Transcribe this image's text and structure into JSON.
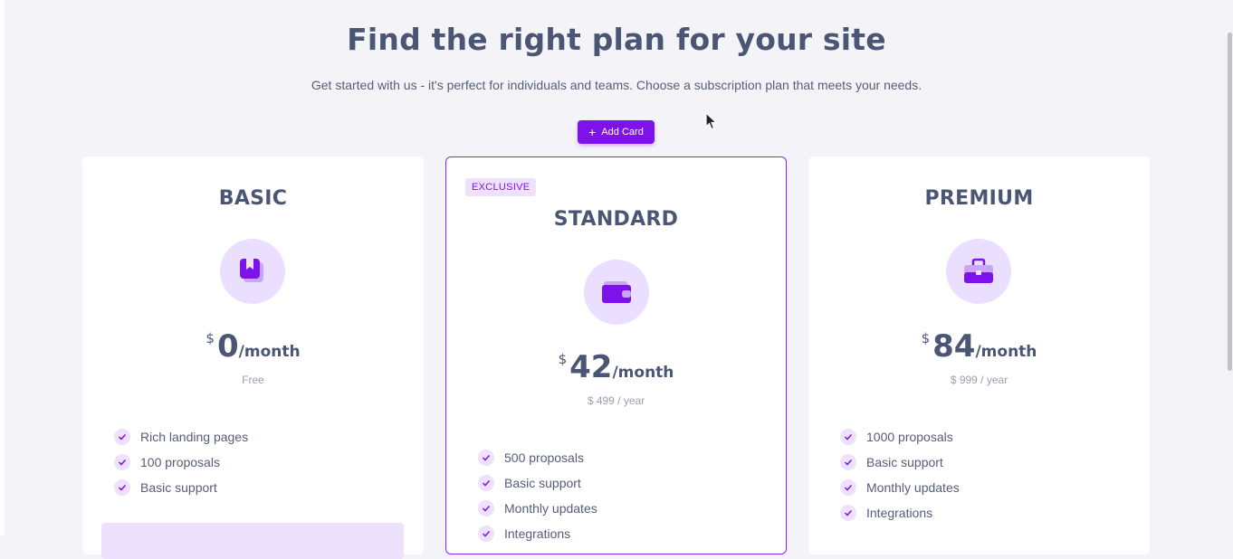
{
  "header": {
    "title": "Find the right plan for your site",
    "subtitle": "Get started with us - it's perfect for individuals and teams. Choose a subscription plan that meets your needs.",
    "add_button_label": "Add Card"
  },
  "colors": {
    "accent": "#7d12ea",
    "accent_light": "#ede1fd",
    "text": "#4b5675",
    "background": "#f4f4f8"
  },
  "plans": [
    {
      "name": "BASIC",
      "icon": "bookmark-icon",
      "currency": "$",
      "amount": "0",
      "period": "/month",
      "note": "Free",
      "features": [
        "Rich landing pages",
        "100 proposals",
        "Basic support"
      ]
    },
    {
      "name": "STANDARD",
      "badge": "EXCLUSIVE",
      "icon": "wallet-icon",
      "currency": "$",
      "amount": "42",
      "period": "/month",
      "note": "$ 499 / year",
      "features": [
        "500 proposals",
        "Basic support",
        "Monthly updates",
        "Integrations"
      ]
    },
    {
      "name": "PREMIUM",
      "icon": "briefcase-icon",
      "currency": "$",
      "amount": "84",
      "period": "/month",
      "note": "$ 999 / year",
      "features": [
        "1000 proposals",
        "Basic support",
        "Monthly updates",
        "Integrations"
      ]
    }
  ]
}
